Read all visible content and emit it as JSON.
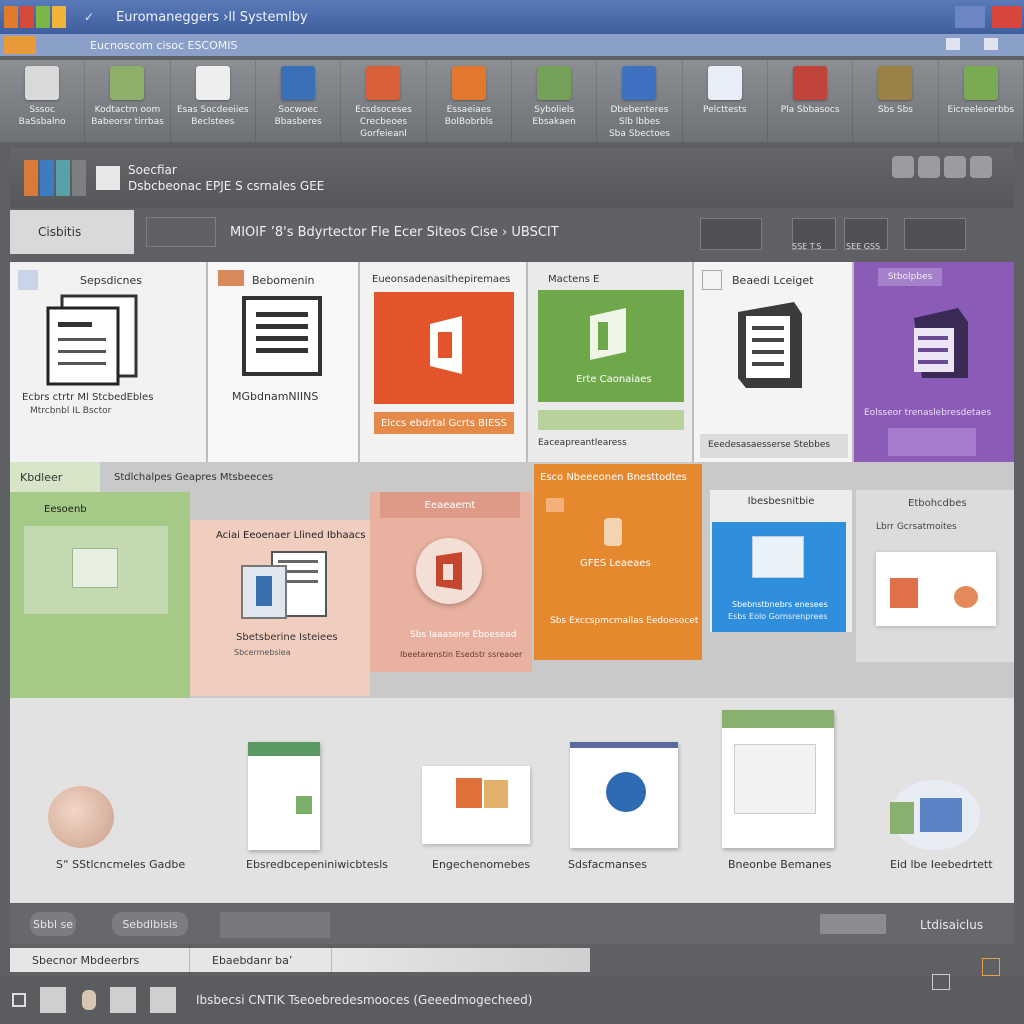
{
  "window": {
    "title": "Euromaneggers ›ll Systemlby",
    "subtitle": "Eucnoscom cisoc  ESCOMIS",
    "colors": {
      "titlebar": "#4a6aaa",
      "close": "#d8453c"
    }
  },
  "ribbon": {
    "items": [
      {
        "label": "Sssoc\nBaSsbalno",
        "color": "#d9d9d9"
      },
      {
        "label": "Kodtactm oom\nBabeorsr tirrbas",
        "color": "#8fae6a"
      },
      {
        "label": "Esas Socdeeiies\nBeclstees",
        "color": "#eeeeee"
      },
      {
        "label": "Socwoec\nBbasberes",
        "color": "#3b70b6"
      },
      {
        "label": "Ecsdsoceses\nCrecbeoes Gorfeieanl",
        "color": "#d8613a"
      },
      {
        "label": "Essaeiaes\nBolBobrbls",
        "color": "#e2782e"
      },
      {
        "label": "Syboliels\nEbsakaen",
        "color": "#74a05a"
      },
      {
        "label": "Dbebenteres\nSlb lbbes\nSba Sbectoes",
        "color": "#3e72c0"
      },
      {
        "label": "Pelcttests",
        "color": "#e8eef7"
      },
      {
        "label": "Pla Sbbasocs",
        "color": "#c0443a"
      },
      {
        "label": "Sbs Sbs",
        "color": "#9a8246"
      },
      {
        "label": "Eicreeleoerbbs",
        "color": "#7aaa52"
      }
    ]
  },
  "header": {
    "line1": "Soecfiar",
    "line2": "Dsbcbeonac EPJE S csrnales GEE"
  },
  "toolbar": {
    "tab": "Cisbitis",
    "text": "MIOIF ’8's Bdyrtector  Fle Ecer  Siteos  Cise  › UBSCIT",
    "box_labels": [
      "SSE T.S",
      "SEE GSS"
    ]
  },
  "cards_row1": [
    {
      "title": "Sepsdicnes",
      "caption": "Ecbrs ctrtr  Ml  StcbedEbles",
      "caption2": "Mtrcbnbl IL Bsctor",
      "theme": "white"
    },
    {
      "title": "Bebomenin",
      "caption": "MGbdnamNIINS",
      "theme": "white"
    },
    {
      "title": "Eueonsadenasithepiremaes",
      "caption": "Elccs ebdrtal Gcrts BIESS",
      "theme": "orange"
    },
    {
      "title": "Mactens E",
      "caption": "Erte Caonaiaes",
      "caption2": "Eaceapreantlearess",
      "theme": "green"
    },
    {
      "title": "Beaedi Lceiget",
      "caption": "Eeedesasaesserse Stebbes",
      "theme": "light"
    },
    {
      "title": "Stbolpbes",
      "caption": "Eolsseor trenaslebresdetaes",
      "theme": "purple"
    }
  ],
  "cards_row2": [
    {
      "title": "Kbdleer",
      "title2": "Stdlchalpes Geapres Mtsbeeces",
      "sub": "Eesoenb",
      "theme": "green"
    },
    {
      "title": "Aciai Eeoenaer Llined Ibhaacs",
      "caption": "Sbetsberine Isteiees",
      "caption2": "Sbcermebsiea",
      "theme": "salmon"
    },
    {
      "title": "Eeaeaemt",
      "caption": "Sbs Iaaasene Eboesead",
      "caption2": "Ibeetarenstin Esedstr ssreaoer",
      "theme": "salmon2"
    },
    {
      "title": "Esco Nbeeeonen Bnesttodtes",
      "caption": "GFES Leaeaes",
      "caption2": "Sbs Exccspmcmallas Eedoesocet",
      "theme": "orange"
    },
    {
      "title": "Ibesbesnitbie",
      "caption": "Sbebnstbnebrs enesees",
      "caption2": "Esbs Eolo Gornsrenprees",
      "theme": "blue"
    },
    {
      "title": "Etbohcdbes",
      "caption": "Lbrr Gcrsatmoites",
      "theme": "white"
    }
  ],
  "bottom": {
    "labels": [
      "S“ SStlcncmeles Gadbe",
      "Ebsredbcepeniniwicbtesls",
      "Engechenomebes",
      "Sdsfacmanses",
      "Bneonbe Bemanes",
      "Eid lbe Ieebedrtett"
    ]
  },
  "status": {
    "btn1": "Sbbl se",
    "btn2": "Sebdlbisis",
    "right": "Ltdisaiclus",
    "tab1": "Sbecnor Mbdeerbrs",
    "tab2": "Ebaebdanr  ba’"
  },
  "taskbar": {
    "text": "Ibsbecsi CNTIK Tseoebredesmooces (Geeedmogecheed)"
  }
}
